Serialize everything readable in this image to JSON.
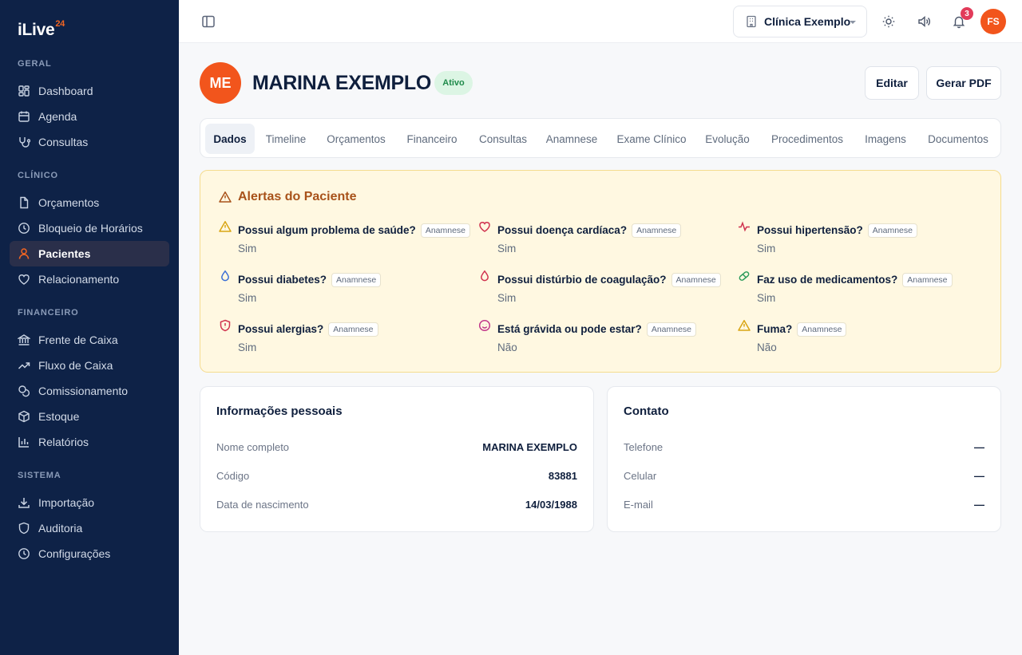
{
  "brand": {
    "name": "iLive",
    "superscript": "24"
  },
  "sidebar": {
    "sections": [
      {
        "title": "GERAL",
        "items": [
          {
            "label": "Dashboard",
            "icon": "dashboard-icon"
          },
          {
            "label": "Agenda",
            "icon": "calendar-icon"
          },
          {
            "label": "Consultas",
            "icon": "stethoscope-icon"
          }
        ]
      },
      {
        "title": "CLÍNICO",
        "items": [
          {
            "label": "Orçamentos",
            "icon": "file-icon"
          },
          {
            "label": "Bloqueio de Horários",
            "icon": "clock-icon"
          },
          {
            "label": "Pacientes",
            "icon": "user-icon",
            "active": true
          },
          {
            "label": "Relacionamento",
            "icon": "heart-icon"
          }
        ]
      },
      {
        "title": "FINANCEIRO",
        "items": [
          {
            "label": "Frente de Caixa",
            "icon": "bank-icon"
          },
          {
            "label": "Fluxo de Caixa",
            "icon": "trending-up-icon"
          },
          {
            "label": "Comissionamento",
            "icon": "coins-icon"
          },
          {
            "label": "Estoque",
            "icon": "box-icon"
          },
          {
            "label": "Relatórios",
            "icon": "bar-chart-icon"
          }
        ]
      },
      {
        "title": "SISTEMA",
        "items": [
          {
            "label": "Importação",
            "icon": "download-icon"
          },
          {
            "label": "Auditoria",
            "icon": "shield-icon"
          },
          {
            "label": "Configurações",
            "icon": "clock-icon"
          }
        ]
      }
    ]
  },
  "topbar": {
    "clinic": "Clínica Exemplo",
    "notification_count": "3",
    "user_initials": "FS"
  },
  "patient": {
    "initials": "ME",
    "name": "MARINA EXEMPLO",
    "status": "Ativo",
    "edit_label": "Editar",
    "pdf_label": "Gerar PDF"
  },
  "tabs": [
    "Dados",
    "Timeline",
    "Orçamentos",
    "Financeiro",
    "Consultas",
    "Anamnese",
    "Exame Clínico",
    "Evolução",
    "Procedimentos",
    "Imagens",
    "Documentos"
  ],
  "alerts": {
    "title": "Alertas do Paciente",
    "tag": "Anamnese",
    "items": [
      {
        "question": "Possui algum problema de saúde?",
        "answer": "Sim",
        "icon": "warning-icon",
        "color": "#d9a514"
      },
      {
        "question": "Possui doença cardíaca?",
        "answer": "Sim",
        "icon": "heart-icon",
        "color": "#d0334f"
      },
      {
        "question": "Possui hipertensão?",
        "answer": "Sim",
        "icon": "pulse-icon",
        "color": "#d0334f"
      },
      {
        "question": "Possui diabetes?",
        "answer": "Sim",
        "icon": "droplet-icon",
        "color": "#3b6fd6"
      },
      {
        "question": "Possui distúrbio de coagulação?",
        "answer": "Sim",
        "icon": "droplet-icon",
        "color": "#d0334f"
      },
      {
        "question": "Faz uso de medicamentos?",
        "answer": "Sim",
        "icon": "pill-icon",
        "color": "#2a9a5a"
      },
      {
        "question": "Possui alergias?",
        "answer": "Sim",
        "icon": "shield-alert-icon",
        "color": "#d0334f"
      },
      {
        "question": "Está grávida ou pode estar?",
        "answer": "Não",
        "icon": "smile-icon",
        "color": "#c2378a"
      },
      {
        "question": "Fuma?",
        "answer": "Não",
        "icon": "warning-icon",
        "color": "#d9a514"
      }
    ]
  },
  "personal": {
    "title": "Informações pessoais",
    "rows": [
      {
        "label": "Nome completo",
        "value": "MARINA EXEMPLO"
      },
      {
        "label": "Código",
        "value": "83881"
      },
      {
        "label": "Data de nascimento",
        "value": "14/03/1988"
      }
    ]
  },
  "contact": {
    "title": "Contato",
    "rows": [
      {
        "label": "Telefone",
        "value": "—"
      },
      {
        "label": "Celular",
        "value": "—"
      },
      {
        "label": "E-mail",
        "value": "—"
      }
    ]
  }
}
